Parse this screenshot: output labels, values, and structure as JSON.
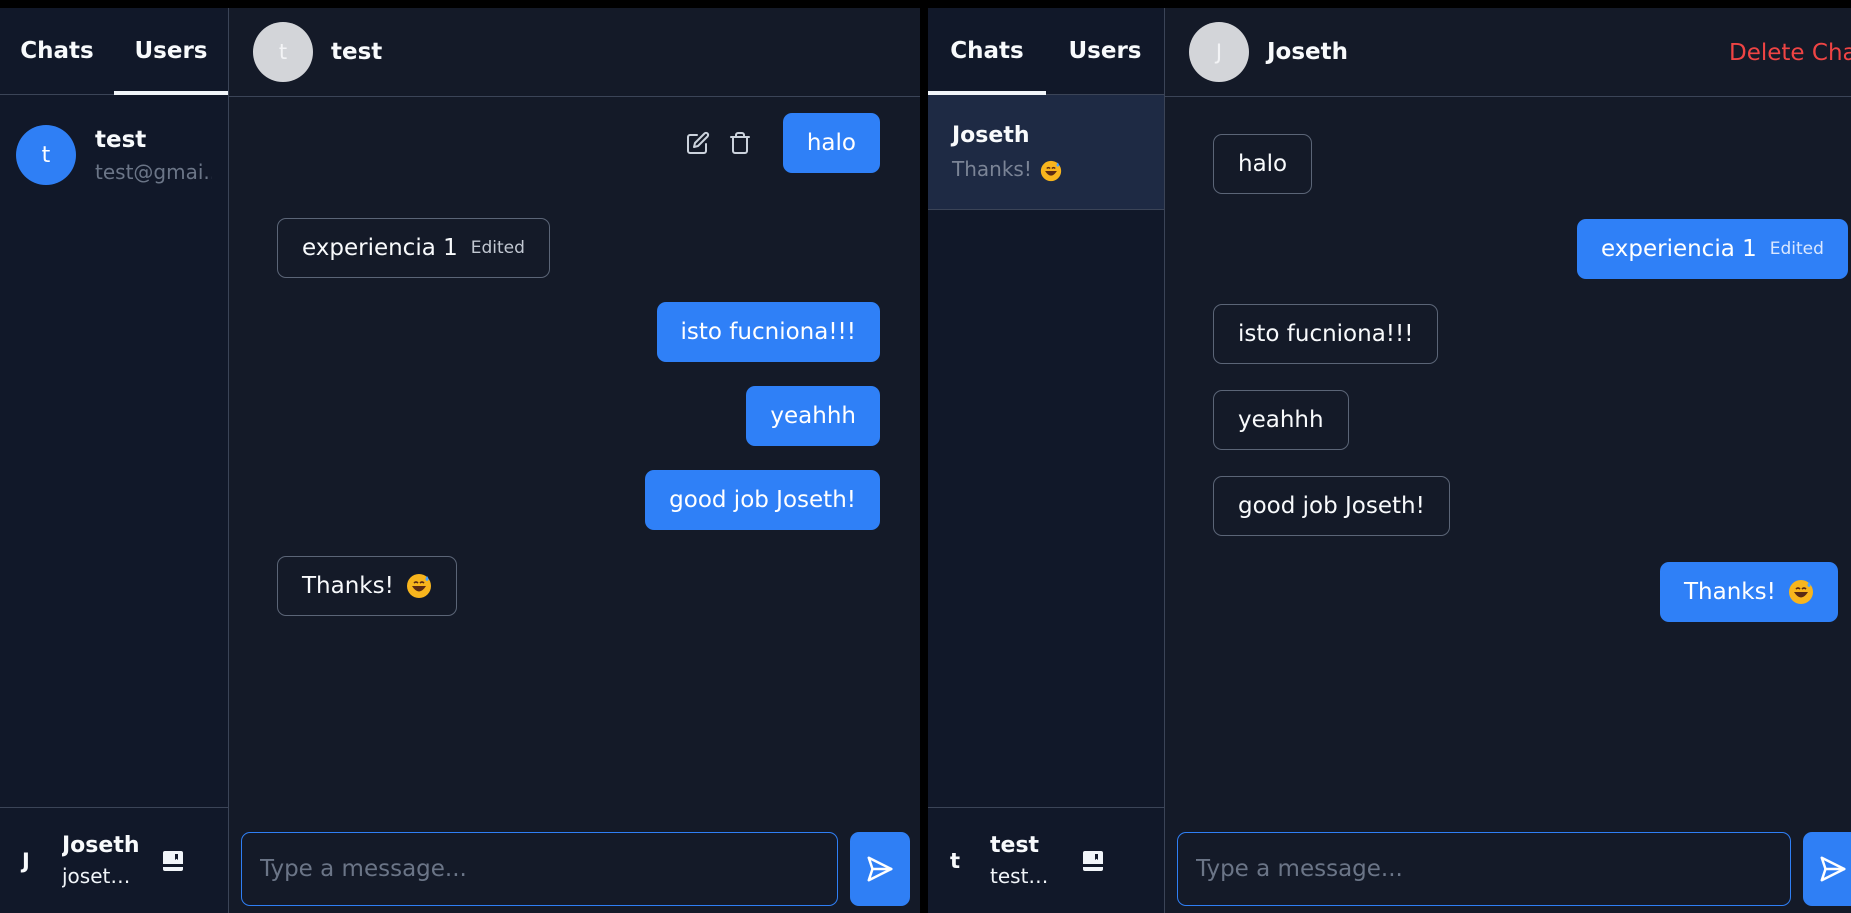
{
  "left_window": {
    "tabs": [
      {
        "label": "Chats",
        "active": false
      },
      {
        "label": "Users",
        "active": true
      }
    ],
    "users": [
      {
        "initial": "t",
        "name": "test",
        "email": "test@gmai..."
      }
    ],
    "footer": {
      "initial": "J",
      "name": "Joseth",
      "email": "joseth..."
    },
    "header": {
      "avatar_initial": "t",
      "name": "test"
    },
    "messages": [
      {
        "text": "halo",
        "direction": "out",
        "edited": false,
        "actions": [
          "edit-icon",
          "trash-icon"
        ]
      },
      {
        "text": "experiencia 1",
        "direction": "in",
        "edited": true,
        "edited_label": "Edited"
      },
      {
        "text": "isto fucniona!!!",
        "direction": "out",
        "edited": false
      },
      {
        "text": "yeahhh",
        "direction": "out",
        "edited": false
      },
      {
        "text": "good job Joseth!",
        "direction": "out",
        "edited": false
      },
      {
        "text": "Thanks!",
        "direction": "in",
        "edited": false,
        "emoji": "grinning-sweat-emoji"
      }
    ],
    "composer": {
      "placeholder": "Type a message..."
    }
  },
  "right_window": {
    "tabs": [
      {
        "label": "Chats",
        "active": true
      },
      {
        "label": "Users",
        "active": false
      }
    ],
    "chats": [
      {
        "name": "Joseth",
        "last_message": "Thanks!",
        "emoji": "grinning-sweat-emoji",
        "selected": true
      }
    ],
    "footer": {
      "initial": "t",
      "name": "test",
      "email": "test@..."
    },
    "header": {
      "avatar_initial": "J",
      "name": "Joseth",
      "delete_label": "Delete Chat"
    },
    "messages": [
      {
        "text": "halo",
        "direction": "in",
        "edited": false
      },
      {
        "text": "experiencia 1",
        "direction": "out",
        "edited": true,
        "edited_label": "Edited"
      },
      {
        "text": "isto fucniona!!!",
        "direction": "in",
        "edited": false
      },
      {
        "text": "yeahhh",
        "direction": "in",
        "edited": false
      },
      {
        "text": "good job Joseth!",
        "direction": "in",
        "edited": false
      },
      {
        "text": "Thanks!",
        "direction": "out",
        "edited": false,
        "emoji": "grinning-sweat-emoji"
      }
    ],
    "composer": {
      "placeholder": "Type a message..."
    }
  },
  "colors": {
    "accent": "#2f7ff5",
    "background": "#141a28",
    "sidebar": "#111829",
    "selected_chat": "#1e2a44",
    "danger": "#ef4444",
    "border": "#3b4457"
  }
}
